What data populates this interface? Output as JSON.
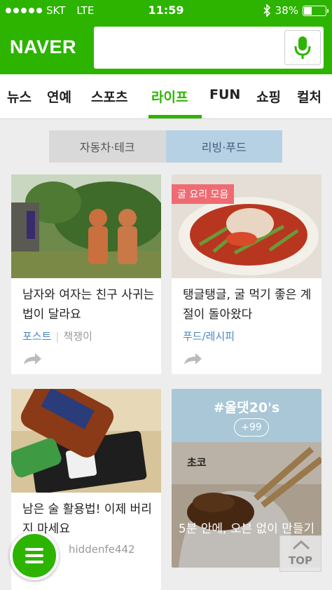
{
  "status_bar": {
    "carrier": "SKT",
    "network": "LTE",
    "time": "11:59",
    "battery": "38%",
    "battery_level": 0.38
  },
  "header": {
    "logo": "NAVER",
    "search_placeholder": ""
  },
  "tabs": [
    {
      "label": "뉴스"
    },
    {
      "label": "연예"
    },
    {
      "label": "스포츠"
    },
    {
      "label": "라이프"
    },
    {
      "label": "FUN"
    },
    {
      "label": "쇼핑"
    },
    {
      "label": "컬처"
    }
  ],
  "active_tab": "라이프",
  "subtabs": [
    {
      "label": "자동차·테크"
    },
    {
      "label": "리빙·푸드"
    }
  ],
  "cards": [
    {
      "title": "남자와 여자는 친구 사귀는 법이 달라요",
      "category": "포스트",
      "author": "책쟁이"
    },
    {
      "badge": "굴 요리 모음",
      "title": "탱글탱글, 굴 먹기 좋은 계절이 돌아왔다",
      "category": "푸드/레시피"
    },
    {
      "title": "남은 술 활용법! 이제 버리지 마세요",
      "author": "hiddenfe442"
    },
    {
      "tag": "#올댓20's",
      "count": "+99",
      "image_label": "초코",
      "caption": "5분 안에, 오븐 없이 만들기"
    }
  ],
  "top_button": "TOP",
  "colors": {
    "brand_green": "#2db400",
    "link_blue": "#4a86c5",
    "subtab_active": "#b7d1e4",
    "badge_pink": "#ef6b73"
  }
}
